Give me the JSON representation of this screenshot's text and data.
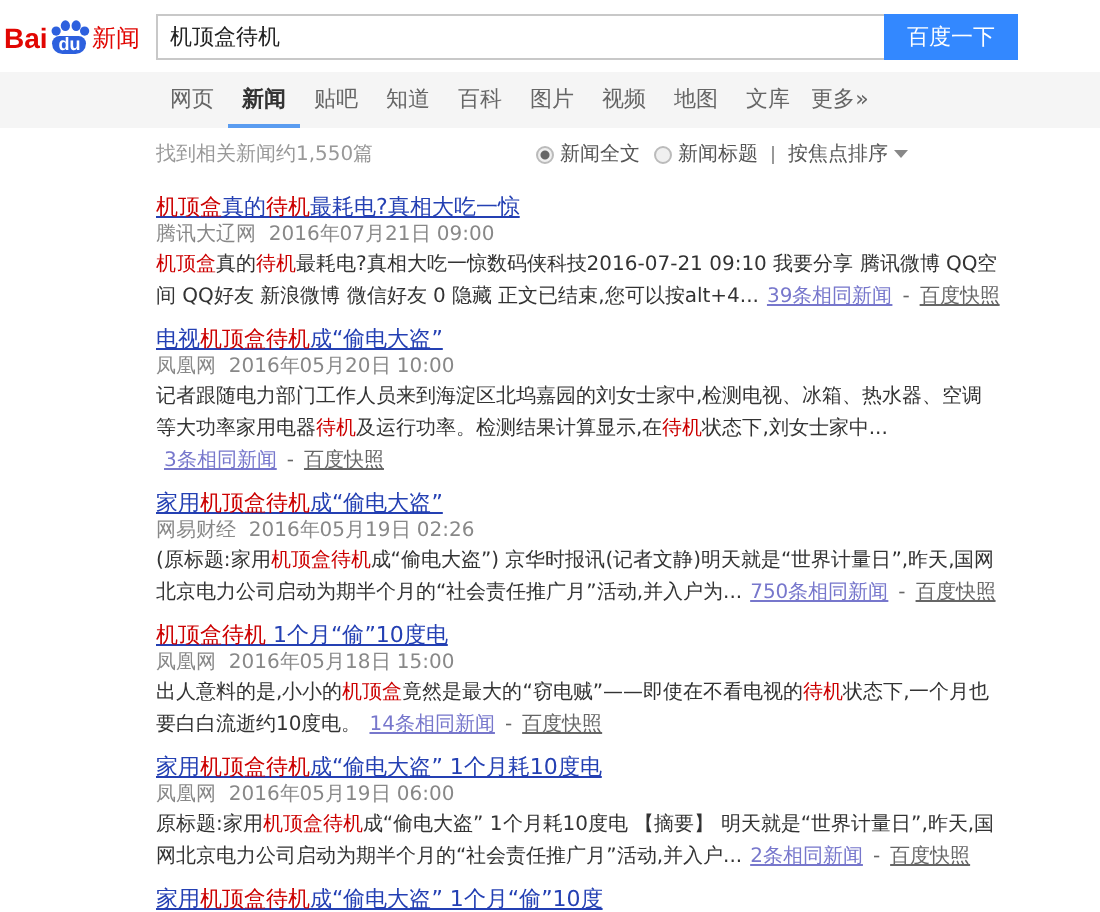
{
  "logo": {
    "left": "Bai",
    "badge": "du",
    "right": "新闻"
  },
  "search": {
    "value": "机顶盒待机",
    "button": "百度一下"
  },
  "tabs": [
    {
      "label": "网页",
      "selected": false
    },
    {
      "label": "新闻",
      "selected": true
    },
    {
      "label": "贴吧",
      "selected": false
    },
    {
      "label": "知道",
      "selected": false
    },
    {
      "label": "百科",
      "selected": false
    },
    {
      "label": "图片",
      "selected": false
    },
    {
      "label": "视频",
      "selected": false
    },
    {
      "label": "地图",
      "selected": false
    },
    {
      "label": "文库",
      "selected": false
    },
    {
      "label": "更多»",
      "selected": false
    }
  ],
  "result_count": "找到相关新闻约1,550篇",
  "scope_options": [
    {
      "label": "新闻全文",
      "selected": true
    },
    {
      "label": "新闻标题",
      "selected": false
    }
  ],
  "sort": {
    "label": "按焦点排序"
  },
  "results": [
    {
      "title": [
        {
          "text": "机顶盒",
          "hit": true
        },
        {
          "text": "真的",
          "hit": false
        },
        {
          "text": "待机",
          "hit": true
        },
        {
          "text": "最耗电?真相大吃一惊",
          "hit": false
        }
      ],
      "source": "腾讯大辽网",
      "time": "2016年07月21日 09:00",
      "snippet_lines": [
        [
          {
            "text": "机顶盒",
            "hit": true
          },
          {
            "text": "真的",
            "hit": false
          },
          {
            "text": "待机",
            "hit": true
          },
          {
            "text": "最耗电?真相大吃一惊数码侠科技2016-07-21 09:10 我要分享 腾讯微博 QQ空",
            "hit": false
          }
        ],
        [
          {
            "text": "间 QQ好友 新浪微博 微信好友 0 隐藏 正文已结束,您可以按alt+4...",
            "hit": false
          }
        ]
      ],
      "related": "39条相同新闻",
      "separator": "-",
      "cache": "百度快照"
    },
    {
      "title": [
        {
          "text": "电视",
          "hit": false
        },
        {
          "text": "机顶盒待机",
          "hit": true
        },
        {
          "text": "成“偷电大盗”",
          "hit": false
        }
      ],
      "source": "凤凰网",
      "time": "2016年05月20日 10:00",
      "snippet_lines": [
        [
          {
            "text": "记者跟随电力部门工作人员来到海淀区北坞嘉园的刘女士家中,检测电视、冰箱、热水器、空调",
            "hit": false
          }
        ],
        [
          {
            "text": "等大功率家用电器",
            "hit": false
          },
          {
            "text": "待机",
            "hit": true
          },
          {
            "text": "及运行功率。检测结果计算显示,在",
            "hit": false
          },
          {
            "text": "待机",
            "hit": true
          },
          {
            "text": "状态下,刘女士家中...",
            "hit": false
          }
        ]
      ],
      "related": "3条相同新闻",
      "separator": "-",
      "cache": "百度快照"
    },
    {
      "title": [
        {
          "text": "家用",
          "hit": false
        },
        {
          "text": "机顶盒待机",
          "hit": true
        },
        {
          "text": "成“偷电大盗”",
          "hit": false
        }
      ],
      "source": "网易财经",
      "time": "2016年05月19日 02:26",
      "snippet_lines": [
        [
          {
            "text": "(原标题:家用",
            "hit": false
          },
          {
            "text": "机顶盒待机",
            "hit": true
          },
          {
            "text": "成“偷电大盗”) 京华时报讯(记者文静)明天就是“世界计量日”,昨天,国网",
            "hit": false
          }
        ],
        [
          {
            "text": "北京电力公司启动为期半个月的“社会责任推广月”活动,并入户为...",
            "hit": false
          }
        ]
      ],
      "related": "750条相同新闻",
      "separator": "-",
      "cache": "百度快照"
    },
    {
      "title": [
        {
          "text": "机顶盒待机",
          "hit": true
        },
        {
          "text": " 1个月“偷”10度电",
          "hit": false
        }
      ],
      "source": "凤凰网",
      "time": "2016年05月18日 15:00",
      "snippet_lines": [
        [
          {
            "text": "出人意料的是,小小的",
            "hit": false
          },
          {
            "text": "机顶盒",
            "hit": true
          },
          {
            "text": "竟然是最大的“窃电贼”——即使在不看电视的",
            "hit": false
          },
          {
            "text": "待机",
            "hit": true
          },
          {
            "text": "状态下,一个月也",
            "hit": false
          }
        ],
        [
          {
            "text": "要白白流逝约10度电。",
            "hit": false
          }
        ]
      ],
      "related": "14条相同新闻",
      "separator": "-",
      "cache": "百度快照"
    },
    {
      "title": [
        {
          "text": "家用",
          "hit": false
        },
        {
          "text": "机顶盒待机",
          "hit": true
        },
        {
          "text": "成“偷电大盗” 1个月耗10度电",
          "hit": false
        }
      ],
      "source": "凤凰网",
      "time": "2016年05月19日 06:00",
      "snippet_lines": [
        [
          {
            "text": "原标题:家用",
            "hit": false
          },
          {
            "text": "机顶盒待机",
            "hit": true
          },
          {
            "text": "成“偷电大盗” 1个月耗10度电 【摘要】 明天就是“世界计量日”,昨天,国",
            "hit": false
          }
        ],
        [
          {
            "text": "网北京电力公司启动为期半个月的“社会责任推广月”活动,并入户...",
            "hit": false
          }
        ]
      ],
      "related": "2条相同新闻",
      "separator": "-",
      "cache": "百度快照"
    },
    {
      "title": [
        {
          "text": "家用",
          "hit": false
        },
        {
          "text": "机顶盒待机",
          "hit": true
        },
        {
          "text": "成“偷电大盗” 1个月“偷”10度",
          "hit": false
        }
      ]
    }
  ]
}
